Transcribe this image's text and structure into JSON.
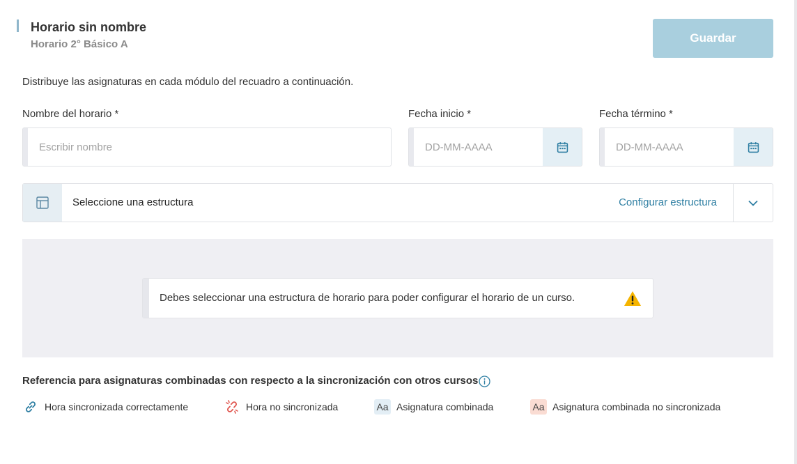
{
  "header": {
    "title": "Horario sin nombre",
    "subtitle": "Horario 2° Básico A",
    "save_label": "Guardar"
  },
  "intro": "Distribuye las asignaturas en cada módulo del recuadro a continuación.",
  "form": {
    "name_label": "Nombre del horario *",
    "name_placeholder": "Escribir nombre",
    "start_label": "Fecha inicio *",
    "start_placeholder": "DD-MM-AAAA",
    "end_label": "Fecha término *",
    "end_placeholder": "DD-MM-AAAA"
  },
  "structure": {
    "select_label": "Seleccione una estructura",
    "config_link": "Configurar estructura"
  },
  "notice": {
    "message": "Debes seleccionar una estructura de horario para poder configurar el horario de un curso."
  },
  "reference": {
    "title": "Referencia para asignaturas combinadas con respecto a la sincronización con otros cursos",
    "items": [
      {
        "label": "Hora sincronizada correctamente",
        "icon": "link-icon"
      },
      {
        "label": "Hora no sincronizada",
        "icon": "broken-link-icon"
      },
      {
        "label": "Asignatura combinada",
        "badge": "Aa"
      },
      {
        "label": "Asignatura combinada no sincronizada",
        "badge": "Aa"
      }
    ]
  },
  "colors": {
    "accent": "#2f7fa3",
    "save_button": "#a9cfde",
    "warning": "#f5b400",
    "error": "#e0564f"
  }
}
